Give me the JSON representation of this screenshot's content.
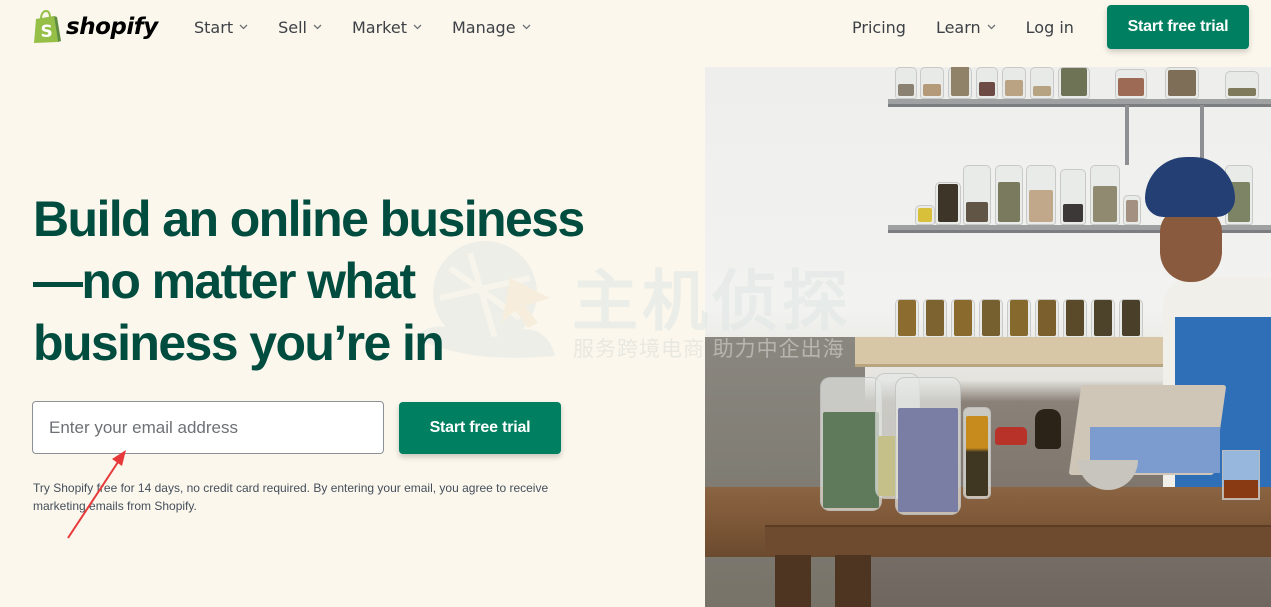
{
  "header": {
    "logo_text": "shopify",
    "nav_left": [
      {
        "label": "Start",
        "has_dropdown": true
      },
      {
        "label": "Sell",
        "has_dropdown": true
      },
      {
        "label": "Market",
        "has_dropdown": true
      },
      {
        "label": "Manage",
        "has_dropdown": true
      }
    ],
    "nav_right": [
      {
        "label": "Pricing",
        "has_dropdown": false
      },
      {
        "label": "Learn",
        "has_dropdown": true
      },
      {
        "label": "Log in",
        "has_dropdown": false
      }
    ],
    "cta_label": "Start free trial"
  },
  "hero": {
    "headline_lines": [
      "Build an online business",
      "—no matter what",
      "business you’re in"
    ],
    "email_placeholder": "Enter your email address",
    "email_value": "",
    "cta_label": "Start free trial",
    "disclaimer": "Try Shopify free for 14 days, no credit card required. By entering your email, you agree to receive marketing emails from Shopify.",
    "image_description": "Woman in blue headscarf and apron working on a tablet at a wooden table with jars of herbs and shelves behind"
  },
  "watermark": {
    "title": "主机侦探",
    "subtitle": "服务跨境电商 助力中企出海"
  },
  "colors": {
    "brand_green": "#008060",
    "headline_green": "#004c3f",
    "page_background": "#fbf7ed",
    "logo_green": "#95bf47",
    "annotation_red": "#e8393a"
  },
  "icons": {
    "logo": "shopify-bag-icon",
    "dropdown": "chevron-down-icon",
    "annotation": "red-arrow-icon"
  }
}
